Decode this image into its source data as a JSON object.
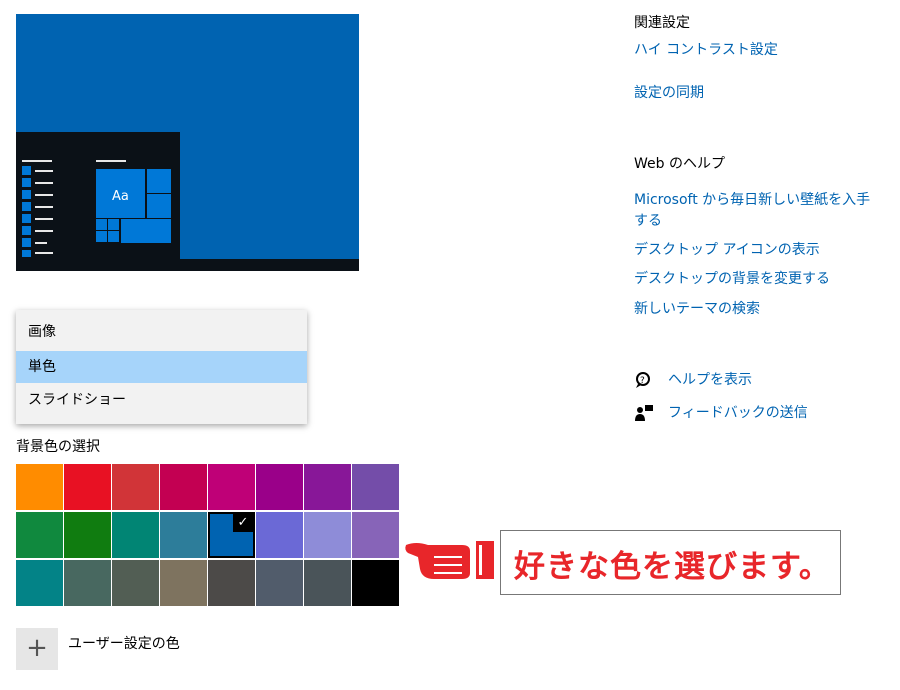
{
  "dropdown": {
    "items": [
      "画像",
      "単色",
      "スライドショー"
    ],
    "selected_index": 1
  },
  "background_color": {
    "label": "背景色の選択",
    "selected_color": "#0063b1",
    "swatches": [
      "#ff8c00",
      "#e81123",
      "#d13438",
      "#c30052",
      "#bf0077",
      "#9a0089",
      "#881798",
      "#744da9",
      "#10893e",
      "#107c10",
      "#018574",
      "#2d7d9a",
      "#0063b1",
      "#6b69d6",
      "#8e8cd8",
      "#8764b8",
      "#038387",
      "#486860",
      "#525e54",
      "#7e735f",
      "#4c4a48",
      "#515c6b",
      "#4a5459",
      "#000000"
    ],
    "check_icon": "checkmark-icon"
  },
  "custom_color": {
    "button_icon": "plus-icon",
    "label": "ユーザー設定の色"
  },
  "preview": {
    "tile_text": "Aa"
  },
  "annotation": {
    "text": "好きな色を選びます。",
    "icon": "pointing-hand-icon",
    "color": "#e8262a"
  },
  "related": {
    "heading": "関連設定",
    "links": [
      "ハイ コントラスト設定",
      "設定の同期"
    ]
  },
  "web_help": {
    "heading": "Web のヘルプ",
    "links": [
      "Microsoft から毎日新しい壁紙を入手する",
      "デスクトップ アイコンの表示",
      "デスクトップの背景を変更する",
      "新しいテーマの検索"
    ]
  },
  "support": {
    "help_label": "ヘルプを表示",
    "feedback_label": "フィードバックの送信"
  }
}
